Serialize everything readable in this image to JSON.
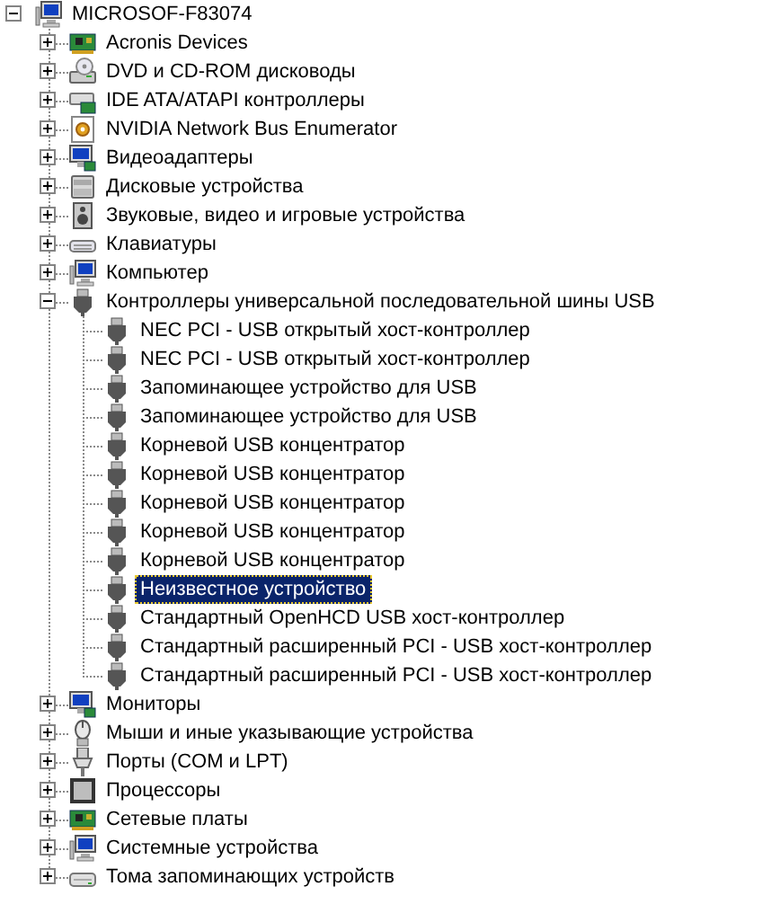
{
  "tree": {
    "label": "MICROSOF-F83074",
    "kind": "computer",
    "expanded": true,
    "selected": false,
    "children": [
      {
        "label": "Acronis Devices",
        "kind": "card",
        "expanded": false,
        "selected": false
      },
      {
        "label": "DVD и CD-ROM дисководы",
        "kind": "cdrom",
        "expanded": false,
        "selected": false
      },
      {
        "label": "IDE ATA/ATAPI контроллеры",
        "kind": "ide",
        "expanded": false,
        "selected": false
      },
      {
        "label": "NVIDIA Network Bus Enumerator",
        "kind": "gear",
        "expanded": false,
        "selected": false
      },
      {
        "label": "Видеоадаптеры",
        "kind": "display",
        "expanded": false,
        "selected": false
      },
      {
        "label": "Дисковые устройства",
        "kind": "disk",
        "expanded": false,
        "selected": false
      },
      {
        "label": "Звуковые, видео и игровые устройства",
        "kind": "sound",
        "expanded": false,
        "selected": false
      },
      {
        "label": "Клавиатуры",
        "kind": "keyboard",
        "expanded": false,
        "selected": false
      },
      {
        "label": "Компьютер",
        "kind": "computer",
        "expanded": false,
        "selected": false
      },
      {
        "label": "Контроллеры универсальной последовательной шины USB",
        "kind": "usb",
        "expanded": true,
        "selected": false,
        "children": [
          {
            "label": "NEC PCI - USB открытый хост-контроллер",
            "kind": "usb",
            "selected": false
          },
          {
            "label": "NEC PCI - USB открытый хост-контроллер",
            "kind": "usb",
            "selected": false
          },
          {
            "label": "Запоминающее устройство для USB",
            "kind": "usb",
            "selected": false
          },
          {
            "label": "Запоминающее устройство для USB",
            "kind": "usb",
            "selected": false
          },
          {
            "label": "Корневой USB концентратор",
            "kind": "usb",
            "selected": false
          },
          {
            "label": "Корневой USB концентратор",
            "kind": "usb",
            "selected": false
          },
          {
            "label": "Корневой USB концентратор",
            "kind": "usb",
            "selected": false
          },
          {
            "label": "Корневой USB концентратор",
            "kind": "usb",
            "selected": false
          },
          {
            "label": "Корневой USB концентратор",
            "kind": "usb",
            "selected": false
          },
          {
            "label": "Неизвестное устройство",
            "kind": "usb",
            "selected": true
          },
          {
            "label": "Стандартный OpenHCD USB хост-контроллер",
            "kind": "usb",
            "selected": false
          },
          {
            "label": "Стандартный расширенный PCI - USB хост-контроллер",
            "kind": "usb",
            "selected": false
          },
          {
            "label": "Стандартный расширенный PCI - USB хост-контроллер",
            "kind": "usb",
            "selected": false
          }
        ]
      },
      {
        "label": "Мониторы",
        "kind": "display",
        "expanded": false,
        "selected": false
      },
      {
        "label": "Мыши и иные указывающие устройства",
        "kind": "mouse",
        "expanded": false,
        "selected": false
      },
      {
        "label": "Порты (COM и LPT)",
        "kind": "port",
        "expanded": false,
        "selected": false
      },
      {
        "label": "Процессоры",
        "kind": "cpu",
        "expanded": false,
        "selected": false
      },
      {
        "label": "Сетевые платы",
        "kind": "card",
        "expanded": false,
        "selected": false
      },
      {
        "label": "Системные устройства",
        "kind": "computer",
        "expanded": false,
        "selected": false
      },
      {
        "label": "Тома запоминающих устройств",
        "kind": "volume",
        "expanded": false,
        "selected": false
      }
    ]
  }
}
